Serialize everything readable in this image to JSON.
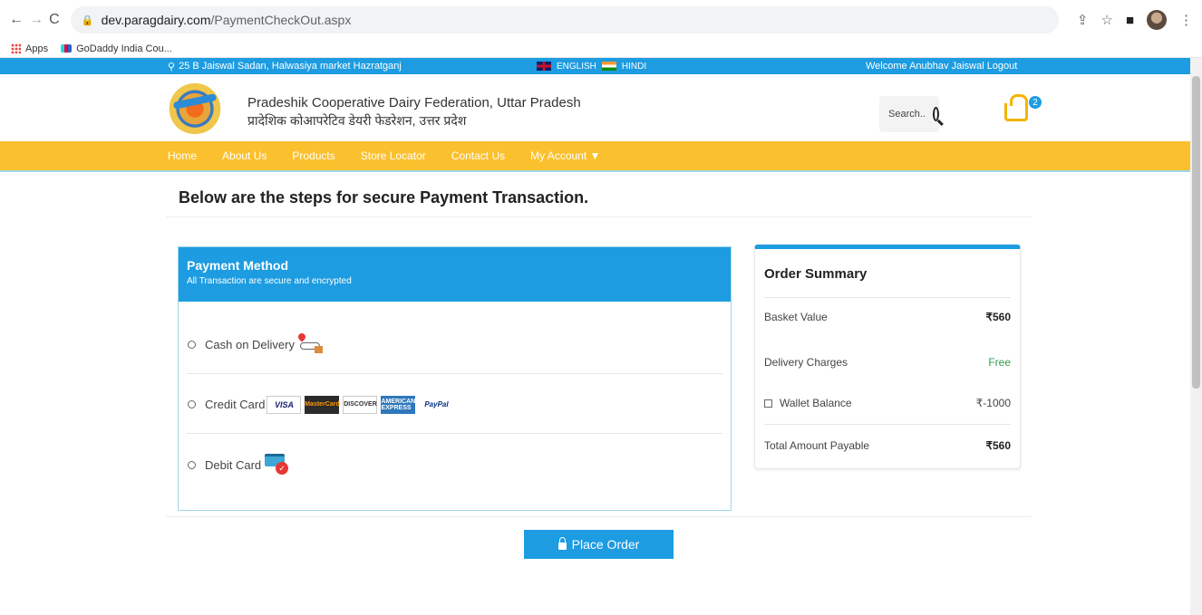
{
  "browser": {
    "url_host": "dev.paragdairy.com",
    "url_path": "/PaymentCheckOut.aspx",
    "bookmarks": [
      {
        "label": "Apps",
        "icon": "apps-grid-icon"
      },
      {
        "label": "GoDaddy India Cou...",
        "icon": "godaddy-icon"
      }
    ]
  },
  "topbar": {
    "address": "25 B Jaiswal Sadan, Halwasiya market Hazratganj",
    "lang_english": "ENGLISH",
    "lang_hindi": "HINDI",
    "welcome": "Welcome Anubhav Jaiswal Logout",
    "color": "#1d9ce1"
  },
  "header": {
    "org_en": "Pradeshik Cooperative Dairy Federation, Uttar Pradesh",
    "org_hi": "प्रादेशिक कोआपरेटिव डेयरी फेडरेशन, उत्तर प्रदेश",
    "search_placeholder": "Search..",
    "cart_count": "2"
  },
  "nav": {
    "items": [
      "Home",
      "About Us",
      "Products",
      "Store Locator",
      "Contact Us",
      "My Account ▼"
    ],
    "color": "#fbc02d"
  },
  "page": {
    "heading": "Below are the steps for secure Payment Transaction."
  },
  "payment": {
    "title": "Payment Method",
    "subtitle": "All Transaction are secure and encrypted",
    "options": [
      {
        "label": "Cash on Delivery"
      },
      {
        "label": "Credit Card"
      },
      {
        "label": "Debit Card"
      }
    ],
    "card_brands": [
      "VISA",
      "MasterCard",
      "DISCOVER",
      "AMERICAN EXPRESS",
      "PayPal"
    ]
  },
  "summary": {
    "title": "Order Summary",
    "rows": [
      {
        "label": "Basket Value",
        "value": "₹560"
      },
      {
        "label": "Delivery Charges",
        "value": "Free"
      },
      {
        "label": "Wallet Balance",
        "value": "₹-1000"
      },
      {
        "label": "Total Amount Payable",
        "value": "₹560"
      }
    ]
  },
  "actions": {
    "place_order": "Place Order"
  }
}
